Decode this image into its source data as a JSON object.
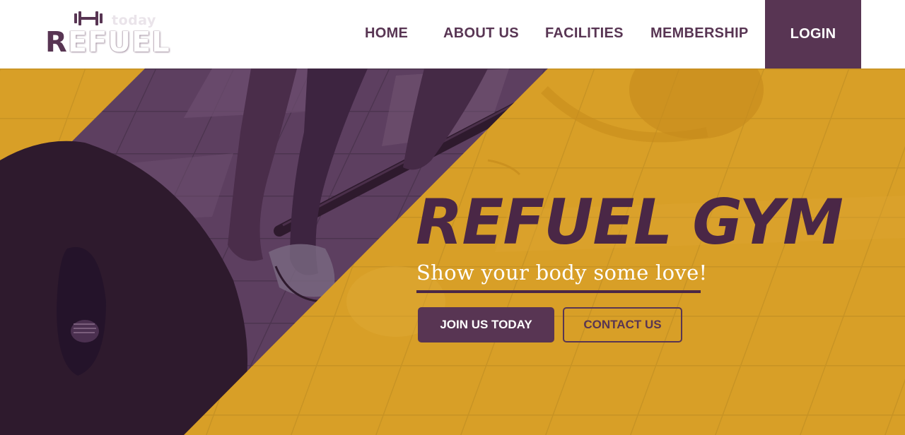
{
  "brand": {
    "small_text": "today",
    "initial": "R",
    "rest": "EFUEL"
  },
  "nav": {
    "items": [
      {
        "label": "HOME"
      },
      {
        "label": "ABOUT US"
      },
      {
        "label": "FACILITIES"
      },
      {
        "label": "MEMBERSHIP"
      }
    ],
    "login_label": "LOGIN"
  },
  "hero": {
    "title": "REFUEL GYM",
    "tagline": "Show your body some love!",
    "primary_button": "JOIN US TODAY",
    "secondary_button": "CONTACT US"
  },
  "colors": {
    "primary": "#583553",
    "accent": "#d89f27",
    "dark": "#2e1a2d"
  },
  "icons": {
    "logo_icon": "dumbbell-icon"
  }
}
